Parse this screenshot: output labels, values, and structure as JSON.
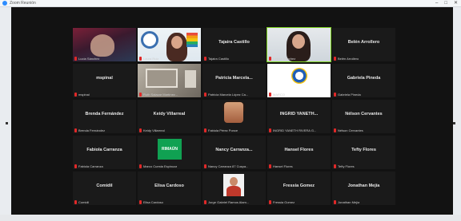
{
  "window": {
    "title": "Zoom Reunión",
    "controls": [
      "–",
      "□",
      "✕"
    ]
  },
  "colors": {
    "gallery_bg": "#121212",
    "tile_bg": "#1a1a1a",
    "active_speaker": "#7ed321",
    "muted": "#e02828"
  },
  "participants": [
    {
      "row": 0,
      "col": 0,
      "center_name": "",
      "label": "Lucía Sánchez",
      "video": "purple"
    },
    {
      "row": 0,
      "col": 1,
      "center_name": "",
      "label": "Laura Ruiz",
      "video": "pinkshirt"
    },
    {
      "row": 0,
      "col": 2,
      "center_name": "Tajaira Castillo",
      "label": "Tajaira Castillo",
      "video": ""
    },
    {
      "row": 0,
      "col": 3,
      "center_name": "",
      "label": "Leticia Sánchez",
      "video": "light",
      "active": true
    },
    {
      "row": 0,
      "col": 4,
      "center_name": "Belén Arrollero",
      "label": "Belén Arrollero",
      "video": ""
    },
    {
      "row": 1,
      "col": 0,
      "center_name": "mspinal",
      "label": "mspinal",
      "video": ""
    },
    {
      "row": 1,
      "col": 1,
      "center_name": "",
      "label": "Ruth Salazar Martínez...",
      "video": "room"
    },
    {
      "row": 1,
      "col": 2,
      "center_name": "Patricia Marcela...",
      "label": "Patricia Marcela López Ca...",
      "video": ""
    },
    {
      "row": 1,
      "col": 3,
      "center_name": "",
      "label": "MARCO",
      "video": "whiteicon"
    },
    {
      "row": 1,
      "col": 4,
      "center_name": "Gabriela Pineda",
      "label": "Gabriela Pineda",
      "video": ""
    },
    {
      "row": 2,
      "col": 0,
      "center_name": "Brenda Fernández",
      "label": "Brenda Fernández",
      "video": ""
    },
    {
      "row": 2,
      "col": 1,
      "center_name": "Keidy Villarreal",
      "label": "Keidy Villarreal",
      "video": ""
    },
    {
      "row": 2,
      "col": 2,
      "center_name": "",
      "label": "Fabiola Pérez Ponce",
      "video": "photo-dark"
    },
    {
      "row": 2,
      "col": 3,
      "center_name": "INGRID YANETH...",
      "label": "INGRID YANETH RIVERA G...",
      "video": ""
    },
    {
      "row": 2,
      "col": 4,
      "center_name": "Nélson Cervantes",
      "label": "Nélson Cervantes",
      "video": ""
    },
    {
      "row": 3,
      "col": 0,
      "center_name": "Fabiola Carranza",
      "label": "Fabiola Carranza",
      "video": ""
    },
    {
      "row": 3,
      "col": 1,
      "center_name": "",
      "label": "Marco Cuesta Espinoza",
      "video": "green",
      "badge": "RIMAÚN"
    },
    {
      "row": 3,
      "col": 2,
      "center_name": "Nancy Carranza...",
      "label": "Nancy Carranza 87 Cuspa...",
      "video": ""
    },
    {
      "row": 3,
      "col": 3,
      "center_name": "Hansel Flores",
      "label": "Hansel Flores",
      "video": ""
    },
    {
      "row": 3,
      "col": 4,
      "center_name": "Tefty Flores",
      "label": "Tefty Flores",
      "video": ""
    },
    {
      "row": 4,
      "col": 0,
      "center_name": "Comidil",
      "label": "Comidil",
      "video": ""
    },
    {
      "row": 4,
      "col": 1,
      "center_name": "Elisa Cardoso",
      "label": "Elisa Cardoso",
      "video": ""
    },
    {
      "row": 4,
      "col": 2,
      "center_name": "",
      "label": "Jorge Gabriel Ramos Alam...",
      "video": "photo-red"
    },
    {
      "row": 4,
      "col": 3,
      "center_name": "Fressia Gomez",
      "label": "Fressia Gomez",
      "video": ""
    },
    {
      "row": 4,
      "col": 4,
      "center_name": "Jonathan Mejía",
      "label": "Jonathan Mejía",
      "video": ""
    }
  ]
}
